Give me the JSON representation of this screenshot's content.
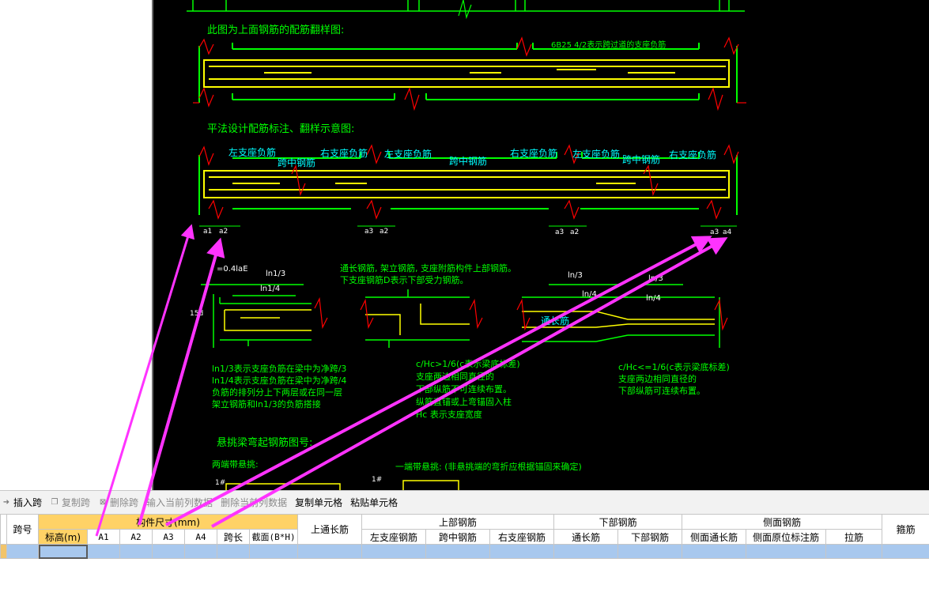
{
  "cad": {
    "title_top": "此图为上面钢筋的配筋翻样图:",
    "note_6b25": "6B25 4/2表示跨过道的支座负筋",
    "title_mid": "平法设计配筋标注、翻样示意图:",
    "labels_top": [
      "左支座负筋",
      "右支座负筋",
      "左支座负筋",
      "右支座负筋",
      "左支座负筋",
      "右支座负筋"
    ],
    "labels_mid": [
      "跨中钢筋",
      "跨中钢筋",
      "跨中钢筋"
    ],
    "a_labels": [
      "a1",
      "a2",
      "a3",
      "a2",
      "a3",
      "a2",
      "a3",
      "a4"
    ],
    "dim_04lae": "=0.4laE",
    "dim_ln1_3": "ln1/3",
    "dim_ln1_4": "ln1/4",
    "dim_15d": "15d",
    "dim_ln_3a": "ln/3",
    "dim_ln_4a": "ln/4",
    "dim_ln_3b": "ln/3",
    "dim_ln_4b": "ln/4",
    "through_bar": "通长筋",
    "note_through_1": "通长钢筋, 架立钢筋, 支座附筋构件上部钢筋。",
    "note_through_2": "下支座钢筋D表示下部受力钢筋。",
    "note_left": [
      "ln1/3表示支座负筋在梁中为净跨/3",
      "ln1/4表示支座负筋在梁中为净跨/4",
      "负筋的排列分上下两层或在同一层",
      "架立钢筋和ln1/3的负筋搭接"
    ],
    "note_middle": [
      "c/Hc>1/6(c表示梁底标差)",
      "支座两边相同直径的",
      "下部纵筋不可连续布置。",
      "纵筋直锚或上弯锚固入柱",
      "Hc 表示支座宽度"
    ],
    "note_right": [
      "c/Hc<=1/6(c表示梁底标差)",
      "支座两边相同直径的",
      "下部纵筋可连续布置。"
    ],
    "title_cant": "悬挑梁弯起钢筋图号:",
    "cant_both": "两端带悬挑:",
    "cant_one": "一端带悬挑: (非悬挑端的弯折应根据锚固来确定)",
    "num_1a": "1#",
    "num_1b": "1#"
  },
  "toolbar": {
    "insert_span": "插入跨",
    "copy_span": "复制跨",
    "delete_span": "删除跨",
    "input_col": "输入当前列数据",
    "delete_col": "删除当前列数据",
    "copy_cell": "复制单元格",
    "paste_cell": "粘贴单元格"
  },
  "table": {
    "h_span_no": "跨号",
    "h_dims": "构件尺寸(mm)",
    "h_top_through": "上通长筋",
    "h_top_rebar": "上部钢筋",
    "h_bottom_rebar": "下部钢筋",
    "h_side_rebar": "侧面钢筋",
    "h_stirrup": "箍筋",
    "sub": {
      "elev": "标高(m)",
      "a1": "A1",
      "a2": "A2",
      "a3": "A3",
      "a4": "A4",
      "span_len": "跨长",
      "section": "截面(B*H)",
      "left_neg": "左支座钢筋",
      "mid_span": "跨中钢筋",
      "right_neg": "右支座钢筋",
      "through": "通长筋",
      "bottom": "下部钢筋",
      "side_through": "侧面通长筋",
      "side_orig": "侧面原位标注筋",
      "tie": "拉筋"
    }
  },
  "colors": {
    "cad_bg": "#000000",
    "cad_green": "#00ff00",
    "cad_yellow": "#ffff00",
    "cad_red": "#ff0000",
    "cad_cyan": "#00ffff",
    "arrow_magenta": "#ff33ff",
    "header_orange": "#ffd266",
    "row_selected": "#a8c8ee"
  }
}
